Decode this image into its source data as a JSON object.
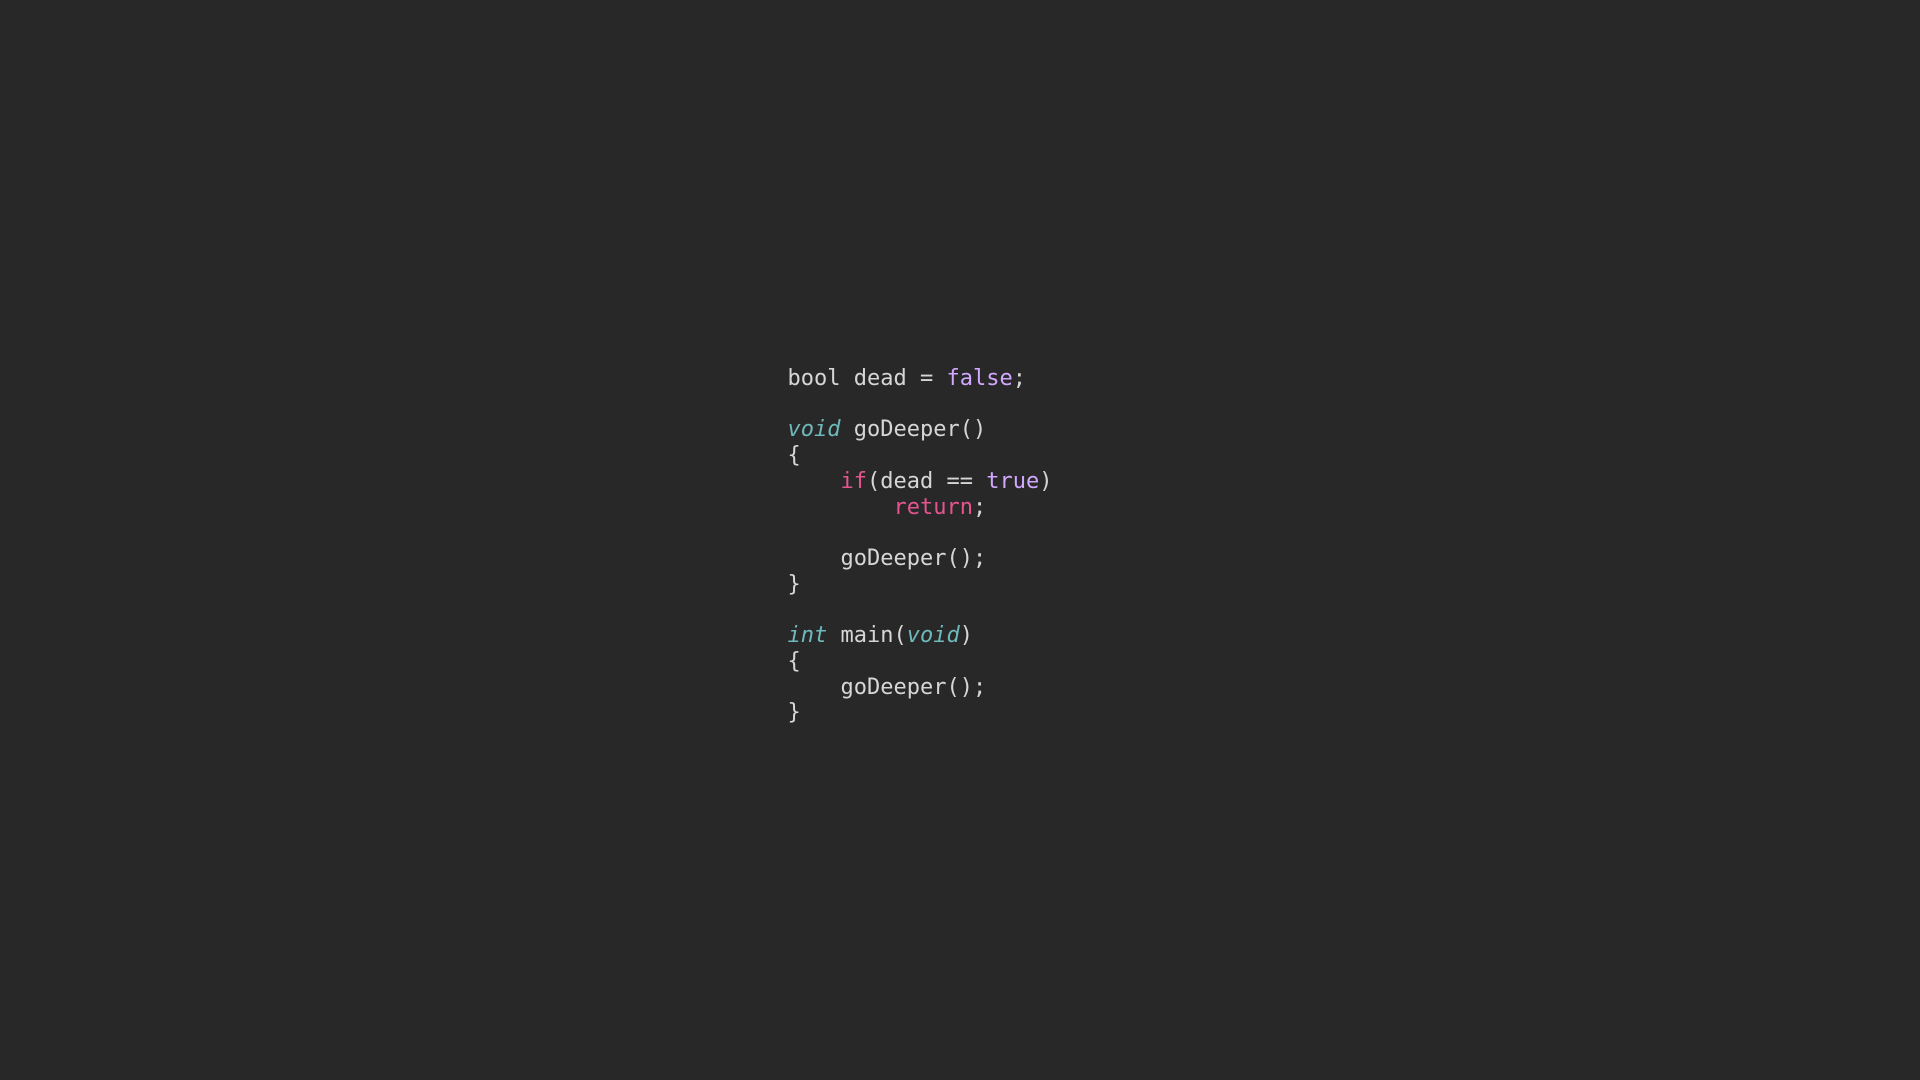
{
  "code": {
    "line1": {
      "t1": "bool",
      "t2": " dead = ",
      "t3": "false",
      "t4": ";"
    },
    "line3": {
      "t1": "void",
      "t2": " goDeeper()"
    },
    "line4": {
      "t1": "{"
    },
    "line5": {
      "t1": "    ",
      "t2": "if",
      "t3": "(dead == ",
      "t4": "true",
      "t5": ")"
    },
    "line6": {
      "t1": "        ",
      "t2": "return",
      "t3": ";"
    },
    "line8": {
      "t1": "    goDeeper();"
    },
    "line9": {
      "t1": "}"
    },
    "line11": {
      "t1": "int",
      "t2": " main(",
      "t3": "void",
      "t4": ")"
    },
    "line12": {
      "t1": "{"
    },
    "line13": {
      "t1": "    goDeeper();"
    },
    "line14": {
      "t1": "}"
    }
  }
}
